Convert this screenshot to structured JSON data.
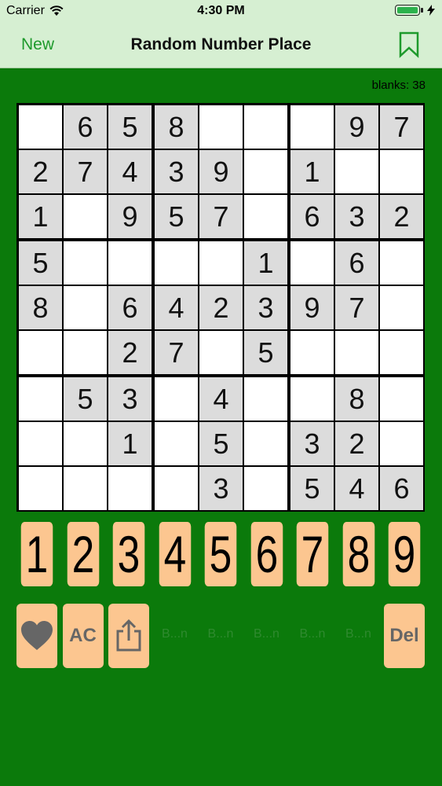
{
  "status_bar": {
    "carrier": "Carrier",
    "time": "4:30 PM"
  },
  "nav": {
    "new_label": "New",
    "title": "Random Number Place"
  },
  "blanks_text": "blanks: 38",
  "board": {
    "values": [
      [
        "",
        "6",
        "5",
        "8",
        "",
        "",
        "",
        "9",
        "7"
      ],
      [
        "2",
        "7",
        "4",
        "3",
        "9",
        "",
        "1",
        "",
        ""
      ],
      [
        "1",
        "",
        "9",
        "5",
        "7",
        "",
        "6",
        "3",
        "2"
      ],
      [
        "5",
        "",
        "",
        "",
        "",
        "1",
        "",
        "6",
        ""
      ],
      [
        "8",
        "",
        "6",
        "4",
        "2",
        "3",
        "9",
        "7",
        ""
      ],
      [
        "",
        "",
        "2",
        "7",
        "",
        "5",
        "",
        "",
        ""
      ],
      [
        "",
        "5",
        "3",
        "",
        "4",
        "",
        "",
        "8",
        ""
      ],
      [
        "",
        "",
        "1",
        "",
        "5",
        "",
        "3",
        "2",
        ""
      ],
      [
        "",
        "",
        "",
        "",
        "3",
        "",
        "5",
        "4",
        "6"
      ]
    ],
    "shaded": [
      [
        0,
        1,
        1,
        1,
        0,
        0,
        0,
        1,
        1
      ],
      [
        1,
        1,
        1,
        1,
        1,
        0,
        1,
        0,
        0
      ],
      [
        1,
        0,
        1,
        1,
        1,
        0,
        1,
        1,
        1
      ],
      [
        1,
        0,
        0,
        0,
        0,
        1,
        0,
        1,
        0
      ],
      [
        1,
        0,
        1,
        1,
        1,
        1,
        1,
        1,
        0
      ],
      [
        0,
        0,
        1,
        1,
        0,
        1,
        0,
        0,
        0
      ],
      [
        0,
        1,
        1,
        0,
        1,
        0,
        0,
        1,
        0
      ],
      [
        0,
        0,
        1,
        0,
        1,
        0,
        1,
        1,
        0
      ],
      [
        0,
        0,
        0,
        0,
        1,
        0,
        1,
        1,
        1
      ]
    ]
  },
  "keypad": [
    "1",
    "2",
    "3",
    "4",
    "5",
    "6",
    "7",
    "8",
    "9"
  ],
  "tools": {
    "ac_label": "AC",
    "del_label": "Del",
    "ghost_labels": [
      "B...n",
      "B...n",
      "B...n",
      "B...n",
      "B...n"
    ]
  },
  "colors": {
    "background": "#0b7a0b",
    "bar": "#d6efd2",
    "accent": "#1e9a2c",
    "key": "#fcc690",
    "cell_shaded": "#dcdcdc"
  },
  "icons": {
    "heart": "heart-icon",
    "share": "share-icon",
    "bookmark": "bookmark-icon",
    "wifi": "wifi-icon",
    "battery": "battery-icon",
    "charging": "charging-bolt-icon"
  }
}
